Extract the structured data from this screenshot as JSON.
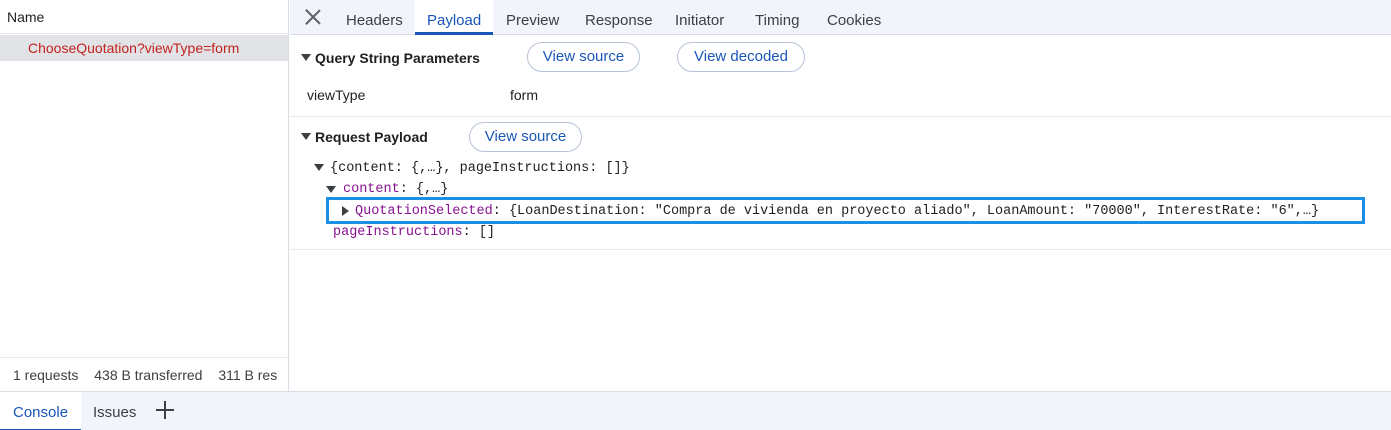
{
  "network_list": {
    "header": "Name",
    "requests": [
      {
        "name": "ChooseQuotation?viewType=form"
      }
    ],
    "status": {
      "requests": "1 requests",
      "transferred": "438 B transferred",
      "resources": "311 B res"
    }
  },
  "details": {
    "tabs": [
      "Headers",
      "Payload",
      "Preview",
      "Response",
      "Initiator",
      "Timing",
      "Cookies"
    ],
    "active_tab": "Payload",
    "query_string": {
      "title": "Query String Parameters",
      "view_source": "View source",
      "view_decoded": "View decoded",
      "params": [
        {
          "key": "viewType",
          "value": "form"
        }
      ]
    },
    "request_payload": {
      "title": "Request Payload",
      "view_source": "View source",
      "tree": {
        "root": "{content: {,…}, pageInstructions: []}",
        "content_key": "content",
        "content_value": "{,…}",
        "quotation_key": "QuotationSelected",
        "quotation_value": "{LoanDestination: \"Compra de vivienda en proyecto aliado\", LoanAmount: \"70000\", InterestRate: \"6\",…}",
        "page_instructions_key": "pageInstructions",
        "page_instructions_value": "[]"
      }
    }
  },
  "drawer": {
    "tabs": [
      "Console",
      "Issues"
    ],
    "active_tab": "Console"
  },
  "colors": {
    "accent": "#1a56b8",
    "request_name": "#c5221f",
    "json_key": "#881391",
    "highlight": "#1a8fe3"
  }
}
